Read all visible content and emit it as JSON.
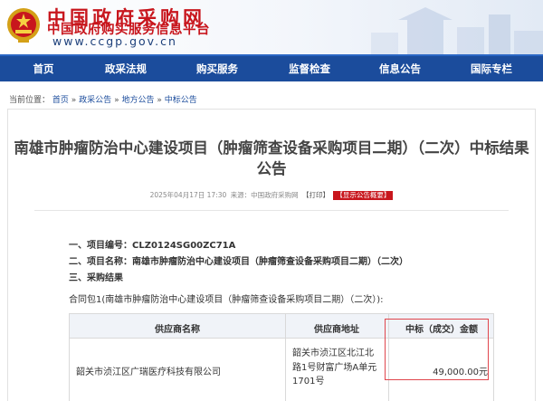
{
  "header": {
    "title": "中国政府采购网",
    "subtitle": "中国政府购买服务信息平台",
    "url": "www.ccgp.gov.cn"
  },
  "nav": {
    "items": [
      "首页",
      "政采法规",
      "购买服务",
      "监督检查",
      "信息公告",
      "国际专栏"
    ]
  },
  "breadcrumb": {
    "label": "当前位置：",
    "items": [
      "首页",
      "政采公告",
      "地方公告",
      "中标公告"
    ],
    "separator": "»"
  },
  "article": {
    "title": "南雄市肿瘤防治中心建设项目（肿瘤筛查设备采购项目二期）（二次）中标结果公告",
    "date": "2025年04月17日 17:30",
    "source": "来源：中国政府采购网",
    "print_label": "【打印】",
    "notice_button": "【显示公告概要】"
  },
  "sections": {
    "project_no_label": "一、项目编号：",
    "project_no": "CLZ0124SG00ZC71A",
    "project_name_label": "二、项目名称：",
    "project_name": "南雄市肿瘤防治中心建设项目（肿瘤筛查设备采购项目二期）（二次）",
    "result_label": "三、采购结果",
    "contract_note": "合同包1(南雄市肿瘤防治中心建设项目（肿瘤筛查设备采购项目二期）（二次）):"
  },
  "table": {
    "headers": [
      "供应商名称",
      "供应商地址",
      "中标（成交）金额"
    ],
    "rows": [
      {
        "name": "韶关市浈江区广瑞医疗科技有限公司",
        "address_lines": [
          "韶关市浈江区北江北",
          "路1号财富广场A单元",
          "1701号"
        ],
        "amount": "49,000.00元"
      }
    ]
  },
  "colors": {
    "brand_red": "#c8161d",
    "nav_blue": "#1b4c9c",
    "highlight": "#e0464d"
  }
}
